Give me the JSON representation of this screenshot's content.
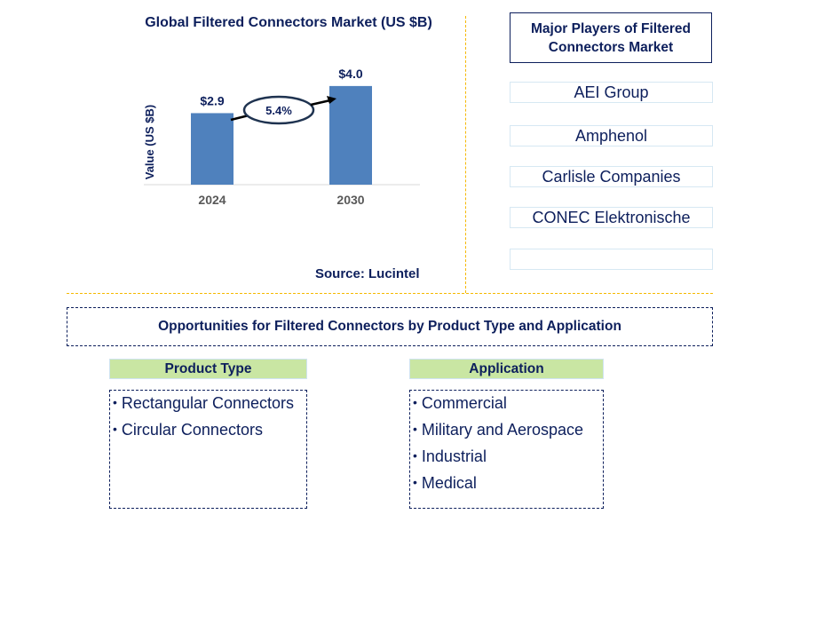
{
  "chart_data": {
    "type": "bar",
    "title": "Global Filtered Connectors Market (US $B)",
    "xlabel": "",
    "ylabel": "Value (US $B)",
    "categories": [
      "2024",
      "2030"
    ],
    "values": [
      2.9,
      4.0
    ],
    "data_labels": [
      "$2.9",
      "$4.0"
    ],
    "ylim": [
      0,
      4.5
    ],
    "grid": false,
    "annotation": {
      "type": "cagr-arrow",
      "label": "5.4%"
    },
    "bar_color": "#4f81bd",
    "source": "Source: Lucintel"
  },
  "players": {
    "title": "Major Players of Filtered Connectors Market",
    "items": [
      "AEI Group",
      "Amphenol",
      "Carlisle Companies",
      "CONEC Elektronische",
      ""
    ]
  },
  "opportunities": {
    "title": "Opportunities for Filtered Connectors by Product Type and Application",
    "product_type": {
      "heading": "Product Type",
      "items": [
        "Rectangular Connectors",
        "Circular Connectors"
      ]
    },
    "application": {
      "heading": "Application",
      "items": [
        "Commercial",
        "Military and Aerospace",
        "Industrial",
        "Medical"
      ]
    }
  },
  "colors": {
    "text": "#0d1f5c",
    "bar": "#4f81bd",
    "divider": "#f5b800",
    "category_head": "#c9e6a3"
  }
}
